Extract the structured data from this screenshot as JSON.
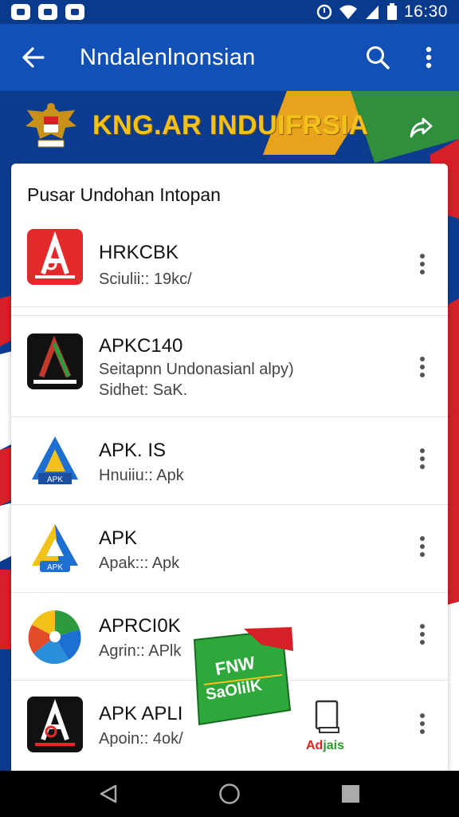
{
  "status_bar": {
    "time": "16:30",
    "left_icons": [
      "notification-icon",
      "app-icon",
      "gallery-icon"
    ],
    "right_icons": [
      "alarm-icon",
      "wifi-icon",
      "signal-icon",
      "battery-icon"
    ]
  },
  "app_bar": {
    "title": "Nndalenlnonsian",
    "back_icon": "arrow-left-icon",
    "search_icon": "search-icon",
    "more_icon": "more-vert-icon"
  },
  "banner": {
    "title": "KNG.AR INDUIFRSIA",
    "share_icon": "share-icon",
    "colors": {
      "blue": "#0d3c8f",
      "red": "#d61f26",
      "gold": "#f2c21a",
      "green": "#2e8b3a"
    }
  },
  "list": {
    "header": "Pusar Undohan Intopan",
    "items": [
      {
        "name": "HRKCBK",
        "lines": [
          "Sciulii:: 19kc/"
        ],
        "icon": "red-a-logo-icon"
      },
      {
        "name": "APKC140",
        "lines": [
          "Seitapnn Undonasianl alpy)",
          "Sidhet: SaK."
        ],
        "icon": "black-a-logo-icon"
      },
      {
        "name": "APK. IS",
        "lines": [
          "Hnuiiu:: Apk"
        ],
        "icon": "blue-triangle-apk-icon"
      },
      {
        "name": "APK",
        "lines": [
          "Apak::: Apk"
        ],
        "icon": "blue-yellow-triangle-apk-icon"
      },
      {
        "name": "APRCI0K",
        "lines": [
          "Agrin:: APlk"
        ],
        "icon": "colorful-circle-icon"
      },
      {
        "name": "APK APLI",
        "lines": [
          "Apoin:: 4ok/"
        ],
        "icon": "black-red-a-logo-icon"
      }
    ]
  },
  "sticker": {
    "line1": "FNW",
    "line2": "SaOlilK"
  },
  "doc_badge": {
    "label_left": "Ad",
    "label_right": "jais"
  },
  "nav_bar": {
    "buttons": [
      "back-nav-icon",
      "home-nav-icon",
      "recents-nav-icon"
    ]
  }
}
